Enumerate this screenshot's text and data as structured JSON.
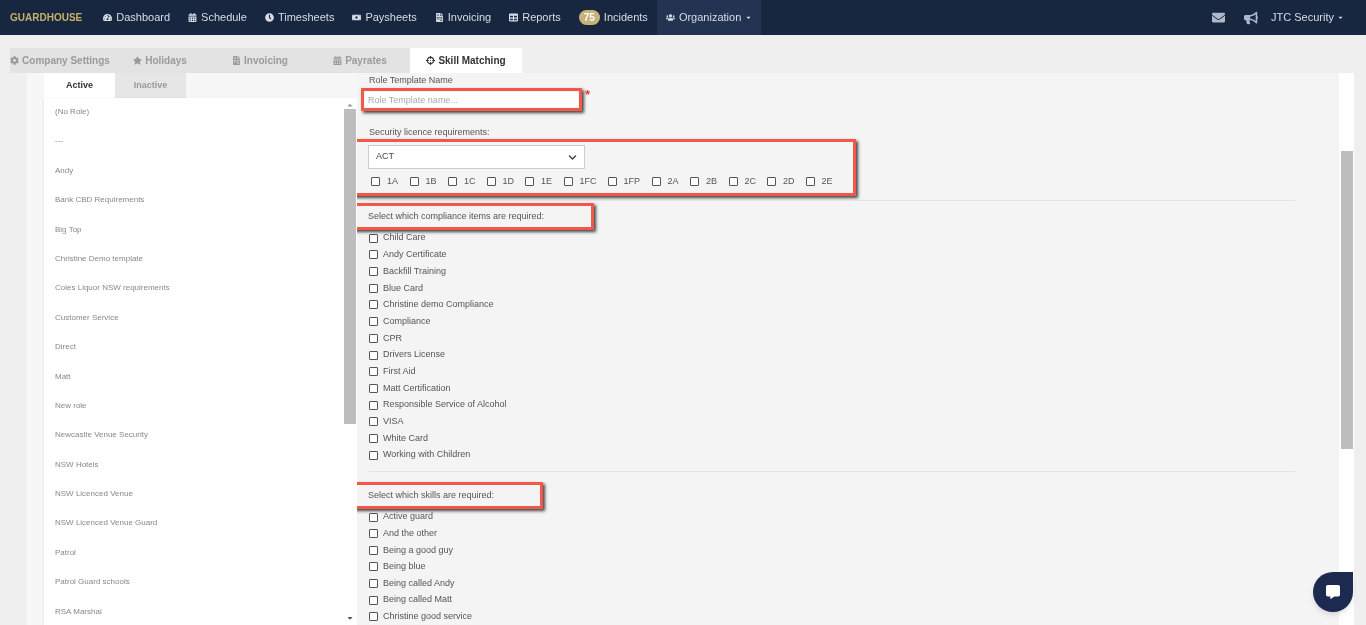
{
  "navbar": {
    "brand": "GUARDHOUSE",
    "items": [
      {
        "label": "Dashboard",
        "selected": false
      },
      {
        "label": "Schedule",
        "selected": false
      },
      {
        "label": "Timesheets",
        "selected": false
      },
      {
        "label": "Paysheets",
        "selected": false
      },
      {
        "label": "Invoicing",
        "selected": false
      },
      {
        "label": "Reports",
        "selected": false
      },
      {
        "label": "Incidents",
        "badge": "75",
        "selected": false
      },
      {
        "label": "Organization",
        "selected": true
      }
    ],
    "user": "JTC Security"
  },
  "tabs": [
    {
      "label": "Company Settings",
      "selected": false
    },
    {
      "label": "Holidays",
      "selected": false
    },
    {
      "label": "Invoicing",
      "selected": false
    },
    {
      "label": "Payrates",
      "selected": false
    },
    {
      "label": "Skill Matching",
      "selected": true
    }
  ],
  "role_tabs": [
    {
      "label": "Active",
      "selected": true
    },
    {
      "label": "Inactive",
      "selected": false
    }
  ],
  "roles": [
    "(No Role)",
    "---",
    "Andy",
    "Bank CBD Requirements",
    "Big Top",
    "Christine Demo template",
    "Coles Liquor NSW requirements",
    "Customer Service",
    "Direct",
    "Matt",
    "New role",
    "Newcastle Venue Security",
    "NSW Hotels",
    "NSW Licenced Venue",
    "NSW Licenced Venue Guard",
    "Patrol",
    "Patrol Guard schools",
    "RSA Marshal"
  ],
  "form": {
    "name_label": "Role Template Name",
    "name_placeholder": "Role Template name...",
    "required_mark": "*",
    "licence_label": "Security licence requirements:",
    "state": "ACT",
    "licence_classes": [
      {
        "label": "1A",
        "checked": false
      },
      {
        "label": "1B",
        "checked": false
      },
      {
        "label": "1C",
        "checked": false
      },
      {
        "label": "1D",
        "checked": false
      },
      {
        "label": "1E",
        "checked": false
      },
      {
        "label": "1FC",
        "checked": false
      },
      {
        "label": "1FP",
        "checked": false
      },
      {
        "label": "2A",
        "checked": false
      },
      {
        "label": "2B",
        "checked": false
      },
      {
        "label": "2C",
        "checked": false
      },
      {
        "label": "2D",
        "checked": false
      },
      {
        "label": "2E",
        "checked": false
      }
    ],
    "compliance_label": "Select which compliance items are required:",
    "compliance": [
      {
        "label": "Child Care",
        "checked": false
      },
      {
        "label": "Andy Certificate",
        "checked": false
      },
      {
        "label": "Backfill Training",
        "checked": false
      },
      {
        "label": "Blue Card",
        "checked": false
      },
      {
        "label": "Christine demo Compliance",
        "checked": false
      },
      {
        "label": "Compliance",
        "checked": false
      },
      {
        "label": "CPR",
        "checked": false
      },
      {
        "label": "Drivers License",
        "checked": false
      },
      {
        "label": "First Aid",
        "checked": false
      },
      {
        "label": "Matt Certification",
        "checked": false
      },
      {
        "label": "Responsible Service of Alcohol",
        "checked": false
      },
      {
        "label": "VISA",
        "checked": false
      },
      {
        "label": "White Card",
        "checked": false
      },
      {
        "label": "Working with Children",
        "checked": false
      }
    ],
    "skills_label": "Select which skills are required:",
    "skills": [
      {
        "label": "Active guard",
        "checked": false
      },
      {
        "label": "And the other",
        "checked": false
      },
      {
        "label": "Being a good guy",
        "checked": false
      },
      {
        "label": "Being blue",
        "checked": false
      },
      {
        "label": "Being called Andy",
        "checked": false
      },
      {
        "label": "Being called Matt",
        "checked": false
      },
      {
        "label": "Christine good service",
        "checked": false
      }
    ]
  }
}
